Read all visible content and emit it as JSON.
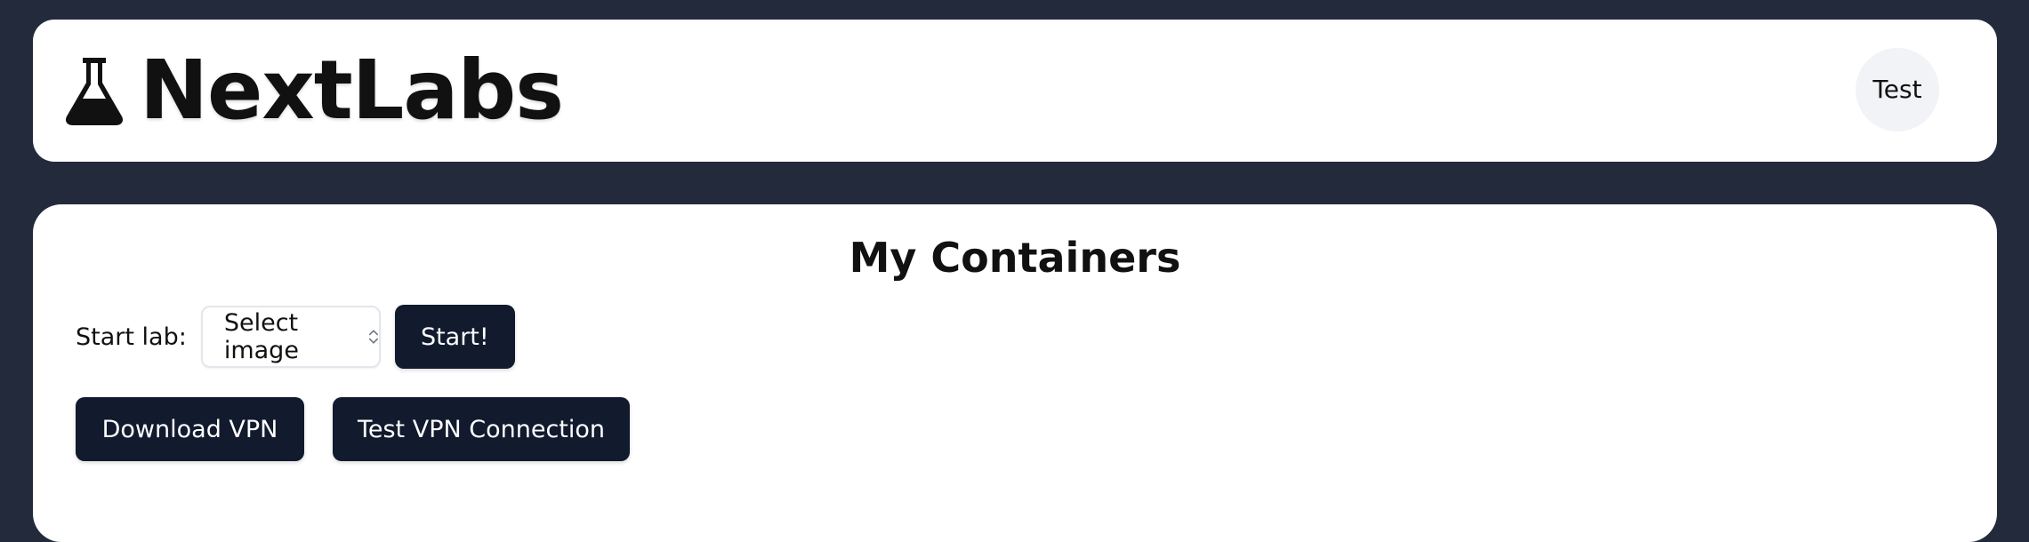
{
  "header": {
    "brand_name": "NextLabs",
    "logo_icon": "flask-icon",
    "user_label": "Test"
  },
  "main": {
    "title": "My Containers",
    "start_lab": {
      "label": "Start lab:",
      "select_value": "Select image",
      "start_button": "Start!"
    },
    "vpn": {
      "download_button": "Download VPN",
      "test_button": "Test VPN Connection"
    }
  },
  "colors": {
    "background": "#232a3c",
    "button": "#121a2e",
    "card": "#ffffff"
  }
}
